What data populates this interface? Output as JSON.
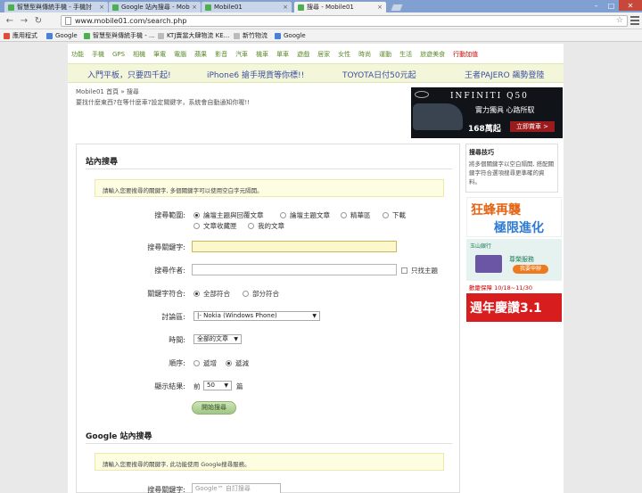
{
  "browser": {
    "tabs": [
      {
        "title": "智慧型與傳統手機 - 手機討"
      },
      {
        "title": "Google 站內搜尋 - Mobi"
      },
      {
        "title": "Mobile01"
      },
      {
        "title": "搜尋 - Mobile01"
      }
    ],
    "url": "www.mobile01.com/search.php",
    "bookmarks": [
      {
        "label": "應用程式"
      },
      {
        "label": "Google"
      },
      {
        "label": "智慧型與傳統手機 - ..."
      },
      {
        "label": "KTJ賣當大肆物流 KE..."
      },
      {
        "label": "新竹物流"
      },
      {
        "label": "Google"
      }
    ]
  },
  "site": {
    "nav": [
      "功能",
      "手機",
      "GPS",
      "相機",
      "筆電",
      "電腦",
      "蘋果",
      "影音",
      "汽車",
      "機車",
      "單車",
      "遊戲",
      "居家",
      "女性",
      "時尚",
      "運動",
      "生活",
      "旅遊美食",
      "行動加值"
    ],
    "promos": [
      "入門平板，只要四千起!",
      "iPhone6 搶手現貨等你標!!",
      "TOYOTA日付50元起",
      "王者PAJERO 飆勢登陸"
    ],
    "breadcrumb": "Mobile01 首頁 » 搜尋",
    "hint": "要找什麼東西?在等什麼車?設定關鍵字，系統會自動通知你喔!!",
    "ad_top": {
      "brand": "INFINITI Q50",
      "slogan": "實力獨具 心路所馭",
      "price": "168萬起",
      "cta": "立即賞車 >"
    }
  },
  "search": {
    "title": "站內搜尋",
    "notice": "請輸入您要搜尋的關鍵字, 多個關鍵字可以使用空白字元隔開。",
    "scope_label": "搜尋範圍:",
    "scope_options": [
      {
        "label": "論壇主題與回覆文章",
        "checked": true
      },
      {
        "label": "論壇主題文章",
        "checked": false
      },
      {
        "label": "精華區",
        "checked": false
      },
      {
        "label": "下載",
        "checked": false
      },
      {
        "label": "文章收藏匣",
        "checked": false
      },
      {
        "label": "我的文章",
        "checked": false
      }
    ],
    "keyword_label": "搜尋關鍵字:",
    "keyword_value": "",
    "author_label": "搜尋作者:",
    "author_value": "",
    "author_only_label": "只找主題",
    "match_label": "關鍵字符合:",
    "match_options": [
      {
        "label": "全部符合",
        "checked": true
      },
      {
        "label": "部分符合",
        "checked": false
      }
    ],
    "forum_label": "討論區:",
    "forum_value": "|- Nokia (Windows Phone)",
    "time_label": "時間:",
    "time_value": "全部的文章",
    "order_label": "順序:",
    "order_options": [
      {
        "label": "遞增",
        "checked": false
      },
      {
        "label": "遞減",
        "checked": true
      }
    ],
    "results_label": "顯示結果:",
    "results_prefix": "前",
    "results_value": "50",
    "results_suffix": "篇",
    "submit_label": "開始搜尋"
  },
  "google_search": {
    "title": "Google 站內搜尋",
    "notice": "請輸入您要搜尋的關鍵字, 此功能使用 Google搜尋服務。",
    "keyword_label": "搜尋關鍵字:",
    "placeholder": "Google™ 自訂搜尋"
  },
  "sidebar": {
    "tips_title": "搜尋技巧",
    "tips_body": "將多個關鍵字以空白隔開, 搭配關鍵字符合選項搜尋更準確的資料。",
    "ad1_line1": "狂蜂再襲",
    "ad1_line2": "極限進化",
    "ad2_bank": "玉山銀行",
    "ad2_text": "尊榮服務",
    "ad2_btn": "我要申辦",
    "ad3_top": "歡慶保障 10/18~11/30",
    "ad3_big": "週年慶讚3.1"
  },
  "colors": {
    "nav_green": "#5c8a2a",
    "promo_blue": "#3c4fa0",
    "notice_bg": "#fdfde2",
    "button_green": "#9fc585"
  }
}
